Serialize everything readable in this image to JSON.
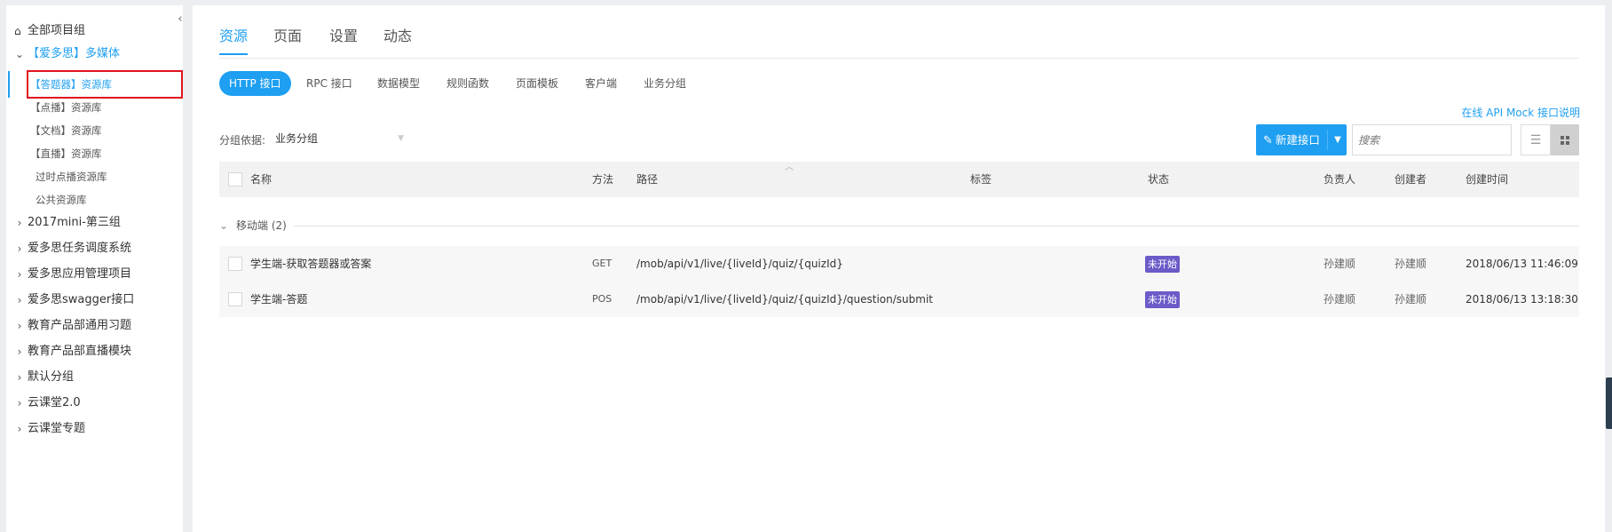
{
  "sidebar": {
    "collapse_icon": "chevron-left-icon",
    "all_groups": "全部项目组",
    "current_group": "【爱多思】多媒体",
    "children": [
      {
        "label": "【答题器】资源库",
        "active": true
      },
      {
        "label": "【点播】资源库"
      },
      {
        "label": "【文档】资源库"
      },
      {
        "label": "【直播】资源库"
      },
      {
        "label": "过时点播资源库"
      },
      {
        "label": "公共资源库"
      }
    ],
    "groups": [
      "2017mini-第三组",
      "爱多思任务调度系统",
      "爱多思应用管理项目",
      "爱多思swagger接口",
      "教育产品部通用习题",
      "教育产品部直播模块",
      "默认分组",
      "云课堂2.0",
      "云课堂专题"
    ]
  },
  "tabs": [
    "资源",
    "页面",
    "设置",
    "动态"
  ],
  "subtabs": [
    "HTTP 接口",
    "RPC 接口",
    "数据模型",
    "规则函数",
    "页面模板",
    "客户端",
    "业务分组"
  ],
  "mock_link": "在线 API Mock 接口说明",
  "group_by": {
    "label": "分组依据:",
    "value": "业务分组"
  },
  "new_button": "新建接口",
  "search_placeholder": "搜索",
  "table": {
    "columns": [
      "名称",
      "方法",
      "路径",
      "标签",
      "状态",
      "负责人",
      "创建者",
      "创建时间"
    ],
    "group": "移动端 (2)",
    "rows": [
      {
        "name": "学生端-获取答题器或答案",
        "method": "GET",
        "path": "/mob/api/v1/live/{liveId}/quiz/{quizId}",
        "tag": "",
        "status": "未开始",
        "owner": "孙建顺",
        "creator": "孙建顺",
        "created": "2018/06/13 11:46:09"
      },
      {
        "name": "学生端-答题",
        "method": "POS",
        "path": "/mob/api/v1/live/{liveId}/quiz/{quizId}/question/submit",
        "tag": "",
        "status": "未开始",
        "owner": "孙建顺",
        "creator": "孙建顺",
        "created": "2018/06/13 13:18:30"
      }
    ]
  },
  "colors": {
    "accent": "#1e9ff2",
    "status_badge": "#6a5bc8",
    "highlight_box": "#e0141e"
  }
}
